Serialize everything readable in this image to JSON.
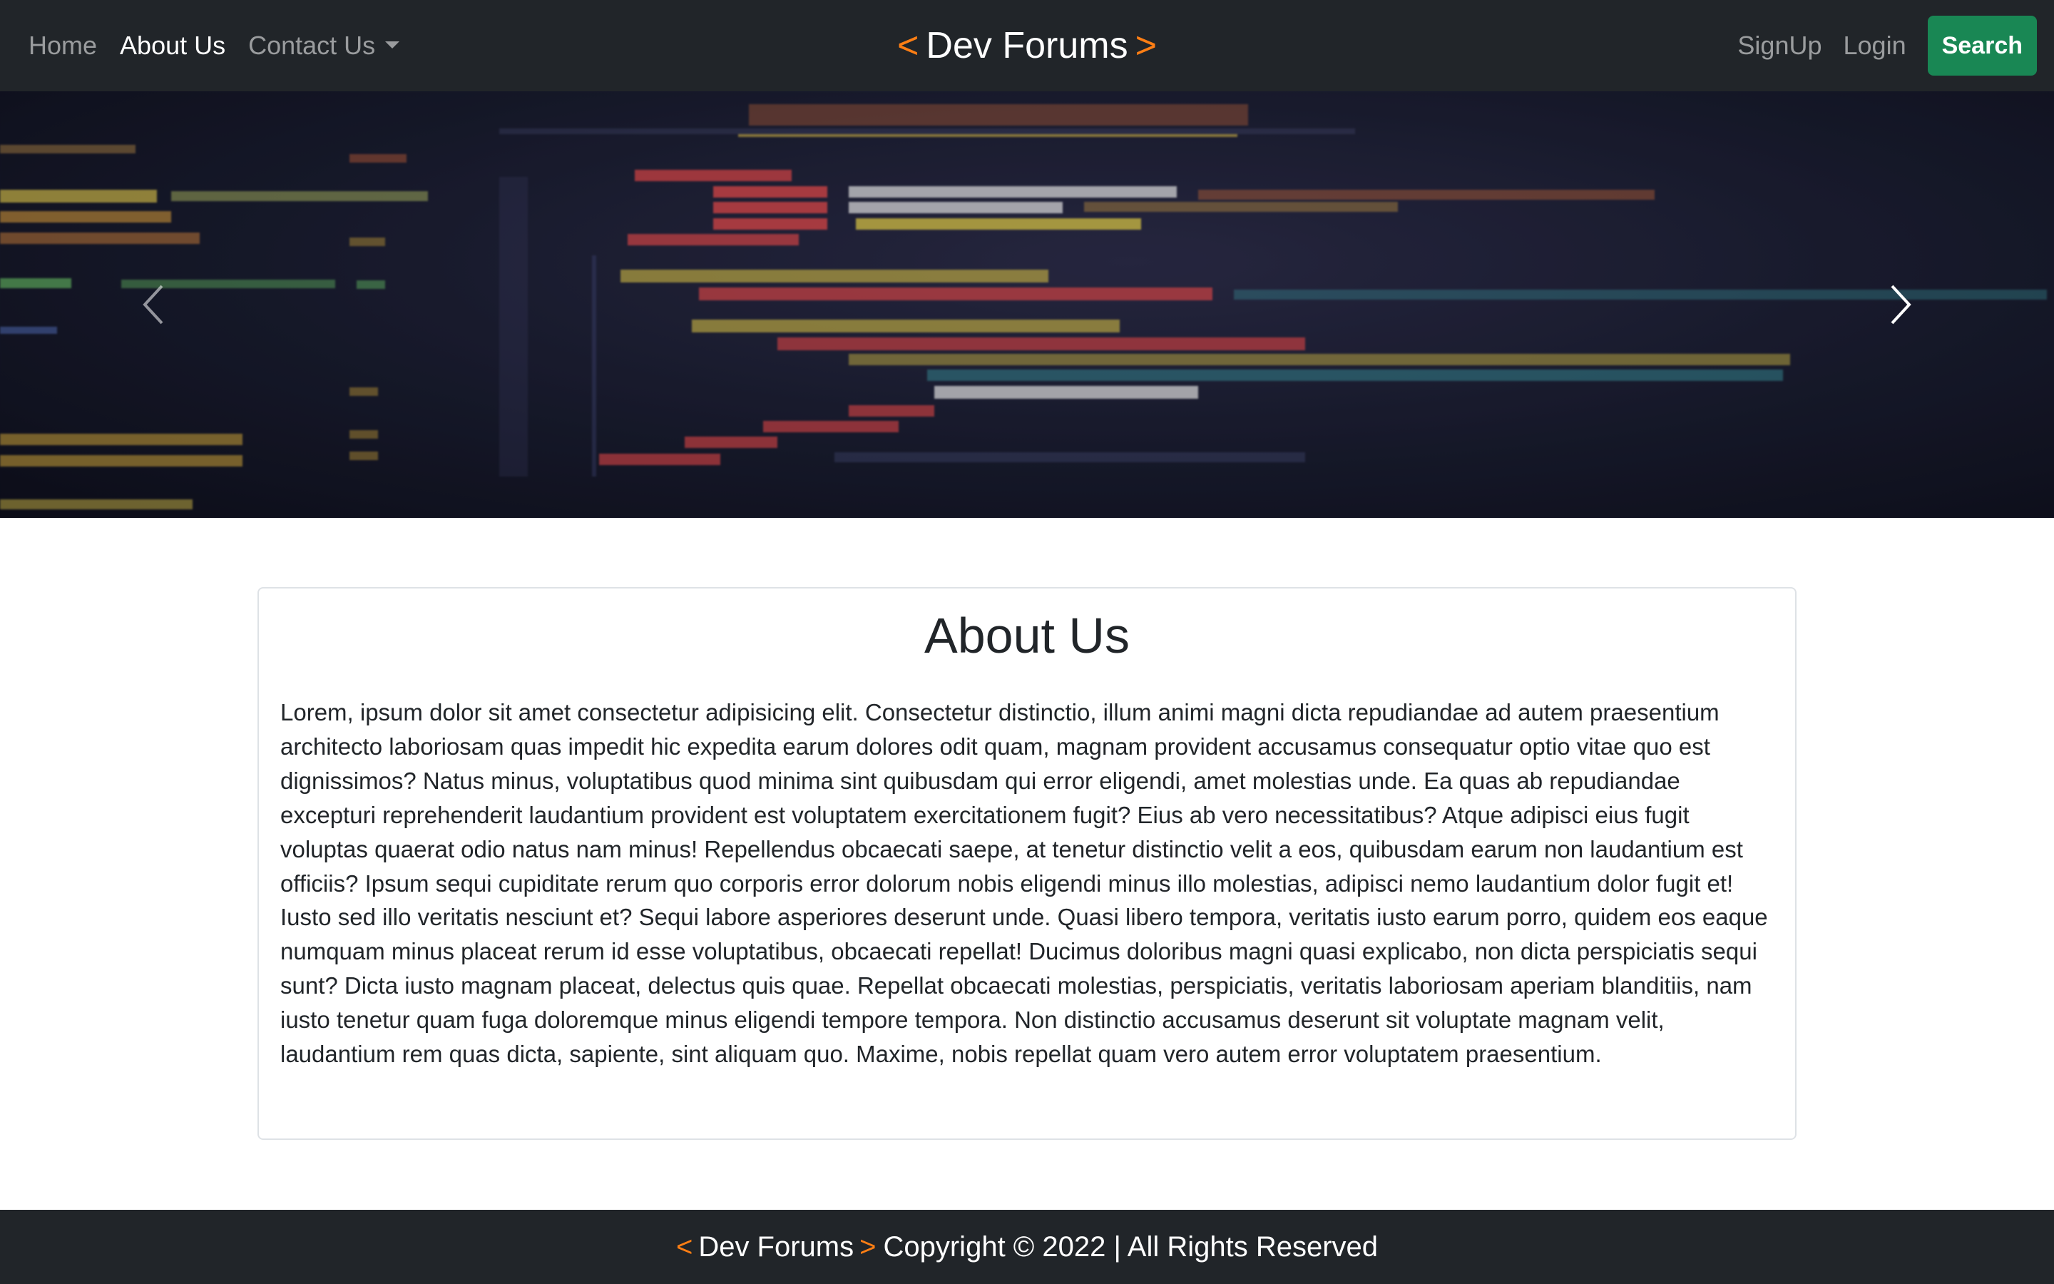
{
  "navbar": {
    "links": [
      {
        "label": "Home"
      },
      {
        "label": "About Us"
      },
      {
        "label": "Contact Us"
      }
    ],
    "brand": {
      "left": "<",
      "name": "Dev Forums",
      "right": ">"
    },
    "signup_label": "SignUp",
    "login_label": "Login",
    "search_label": "Search"
  },
  "carousel": {
    "prev_icon": "chevron-left-icon",
    "next_icon": "chevron-right-icon"
  },
  "about": {
    "title": "About Us",
    "body": "Lorem, ipsum dolor sit amet consectetur adipisicing elit. Consectetur distinctio, illum animi magni dicta repudiandae ad autem praesentium architecto laboriosam quas impedit hic expedita earum dolores odit quam, magnam provident accusamus consequatur optio vitae quo est dignissimos? Natus minus, voluptatibus quod minima sint quibusdam qui error eligendi, amet molestias unde. Ea quas ab repudiandae excepturi reprehenderit laudantium provident est voluptatem exercitationem fugit? Eius ab vero necessitatibus? Atque adipisci eius fugit voluptas quaerat odio natus nam minus! Repellendus obcaecati saepe, at tenetur distinctio velit a eos, quibusdam earum non laudantium est officiis? Ipsum sequi cupiditate rerum quo corporis error dolorum nobis eligendi minus illo molestias, adipisci nemo laudantium dolor fugit et! Iusto sed illo veritatis nesciunt et? Sequi labore asperiores deserunt unde. Quasi libero tempora, veritatis iusto earum porro, quidem eos eaque numquam minus placeat rerum id esse voluptatibus, obcaecati repellat! Ducimus doloribus magni quasi explicabo, non dicta perspiciatis sequi sunt? Dicta iusto magnam placeat, delectus quis quae. Repellat obcaecati molestias, perspiciatis, veritatis laboriosam aperiam blanditiis, nam iusto tenetur quam fuga doloremque minus eligendi tempore tempora. Non distinctio accusamus deserunt sit voluptate magnam velit, laudantium rem quas dicta, sapiente, sint aliquam quo. Maxime, nobis repellat quam vero autem error voluptatem praesentium."
  },
  "footer": {
    "left": "<",
    "name": "Dev Forums",
    "right": ">",
    "copyright": "Copyright © 2022 | All Rights Reserved"
  },
  "colors": {
    "navbar_bg": "#212529",
    "accent": "#fd7e14",
    "search_button": "#198754"
  }
}
